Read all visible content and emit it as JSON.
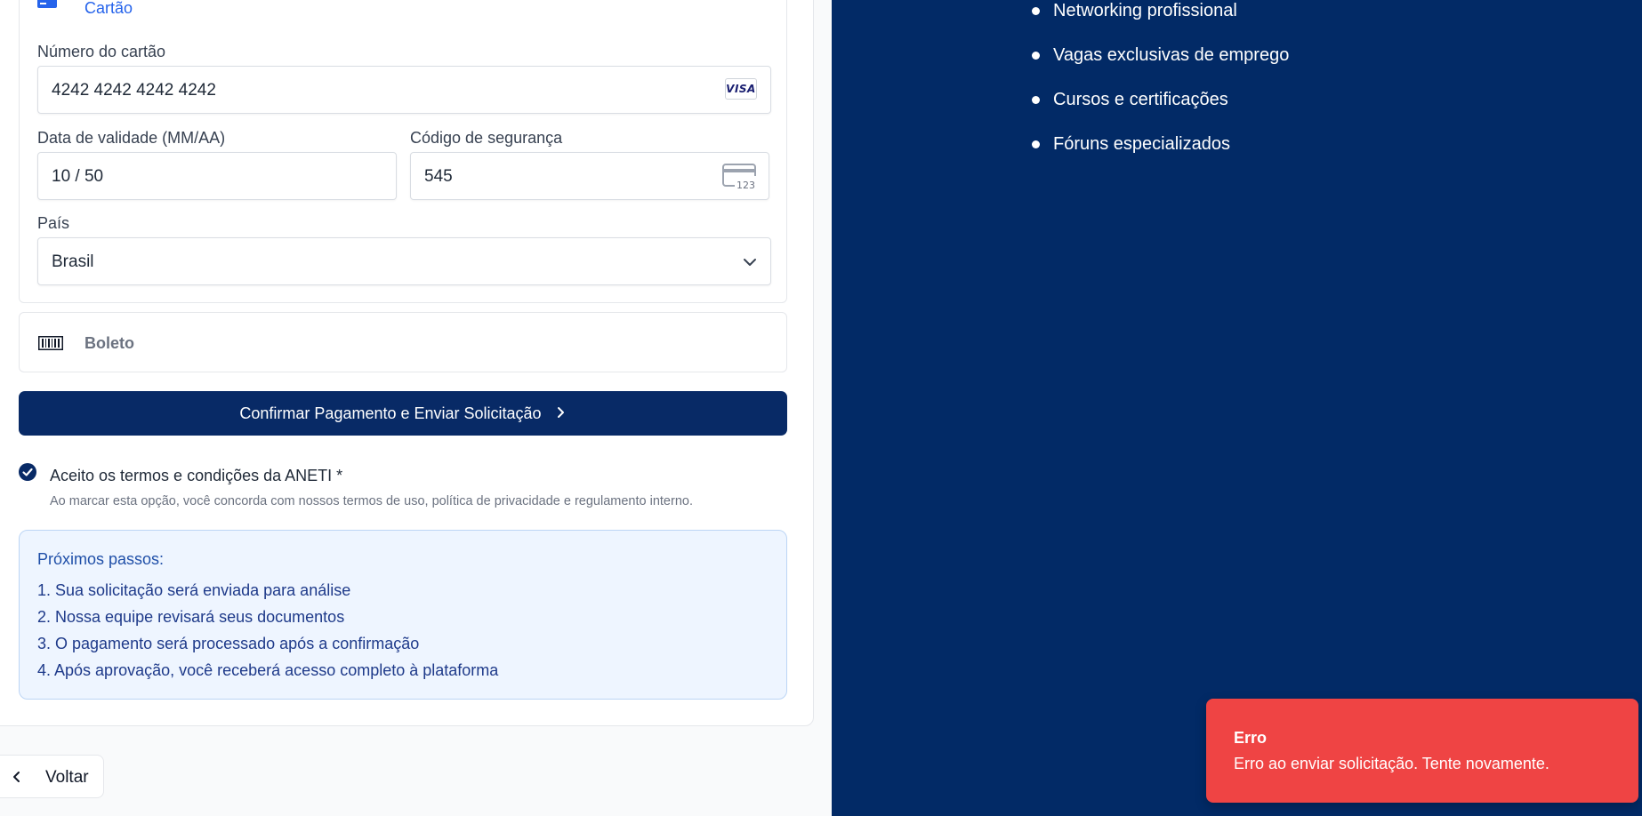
{
  "payment": {
    "methods": {
      "card_label": "Cartão",
      "boleto_label": "Boleto"
    },
    "card": {
      "number_label": "Número do cartão",
      "number_value": "4242 4242 4242 4242",
      "brand": "VISA",
      "expiry_label": "Data de validade (MM/AA)",
      "expiry_value": "10 / 50",
      "cvc_label": "Código de segurança",
      "cvc_value": "545",
      "cvc_icon_text": "123",
      "country_label": "País",
      "country_value": "Brasil"
    },
    "confirm_label": "Confirmar Pagamento e Enviar Solicitação"
  },
  "terms": {
    "label": "Aceito os termos e condições da ANETI *",
    "help": "Ao marcar esta opção, você concorda com nossos termos de uso, política de privacidade e regulamento interno.",
    "checked": true
  },
  "next_steps": {
    "title": "Próximos passos:",
    "items": [
      "1. Sua solicitação será enviada para análise",
      "2. Nossa equipe revisará seus documentos",
      "3. O pagamento será processado após a confirmação",
      "4. Após aprovação, você receberá acesso completo à plataforma"
    ]
  },
  "nav": {
    "back_label": "Voltar"
  },
  "benefits": {
    "items": [
      "Networking profissional",
      "Vagas exclusivas de emprego",
      "Cursos e certificações",
      "Fóruns especializados"
    ]
  },
  "toast": {
    "title": "Erro",
    "message": "Erro ao enviar solicitação. Tente novamente."
  },
  "colors": {
    "brand_navy": "#082a66",
    "panel_navy": "#022a66",
    "error_red": "#ef4444",
    "link_blue": "#2563eb"
  },
  "icons": {
    "card": "credit-card-icon",
    "cvc": "card-cvc-icon",
    "boleto": "barcode-icon",
    "select": "chevron-down-icon",
    "confirm": "chevron-right-icon",
    "back": "chevron-left-icon",
    "check": "check-icon"
  }
}
